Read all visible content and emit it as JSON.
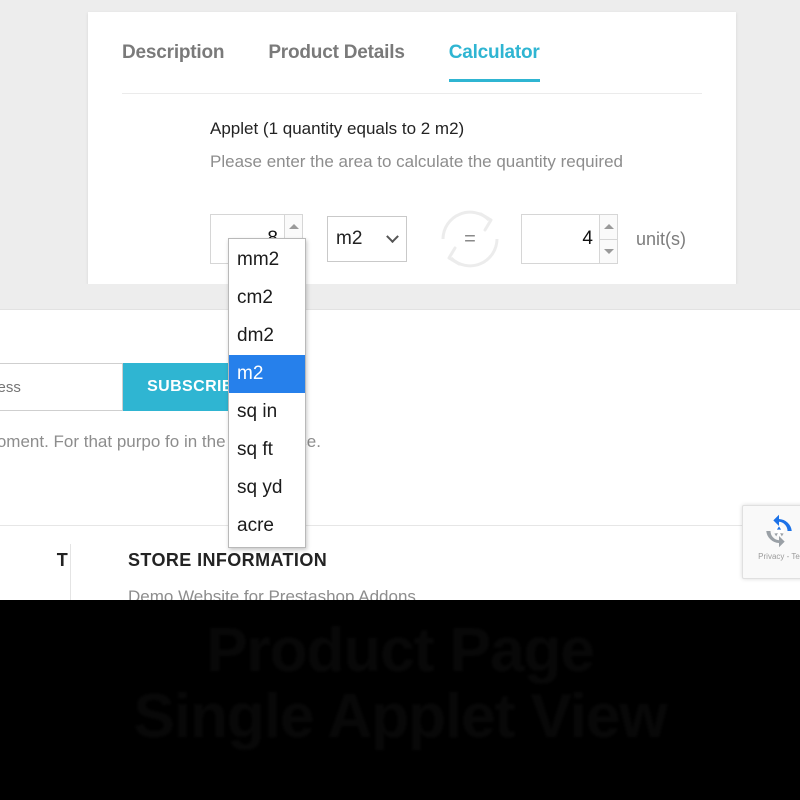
{
  "tabs": [
    {
      "label": "Description",
      "active": false
    },
    {
      "label": "Product Details",
      "active": false
    },
    {
      "label": "Calculator",
      "active": true
    }
  ],
  "calculator": {
    "title": "Applet (1 quantity equals to 2 m2)",
    "subtitle": "Please enter the area to calculate the quantity required",
    "area_value": "8",
    "unit_selected": "m2",
    "equals_symbol": "=",
    "result_value": "4",
    "result_label": "unit(s)",
    "refresh_icon": "refresh-circular-arrows-icon",
    "dropdown_options": [
      "mm2",
      "cm2",
      "dm2",
      "m2",
      "sq in",
      "sq ft",
      "sq yd",
      "acre"
    ],
    "dropdown_selected": "m2"
  },
  "newsletter": {
    "email_value": "",
    "email_placeholder": "Your email address",
    "subscribe_label": "SUBSCRIBE",
    "legal_text": "ny moment. For that purpo fo in the legal notice."
  },
  "footer": {
    "col_a_title": "T",
    "store_info_title": "STORE INFORMATION",
    "store_info_text": "Demo Website for Prestashop Addons"
  },
  "recaptcha": {
    "label": "Privacy - Te",
    "icon": "recaptcha-icon"
  },
  "overlay": {
    "line1": "Product Page",
    "line2": "Single Applet View"
  },
  "colors": {
    "accent": "#2fb5d2",
    "selection": "#2680eb",
    "page_bg": "#ededed",
    "text": "#232323",
    "muted": "#8d8d8d"
  }
}
